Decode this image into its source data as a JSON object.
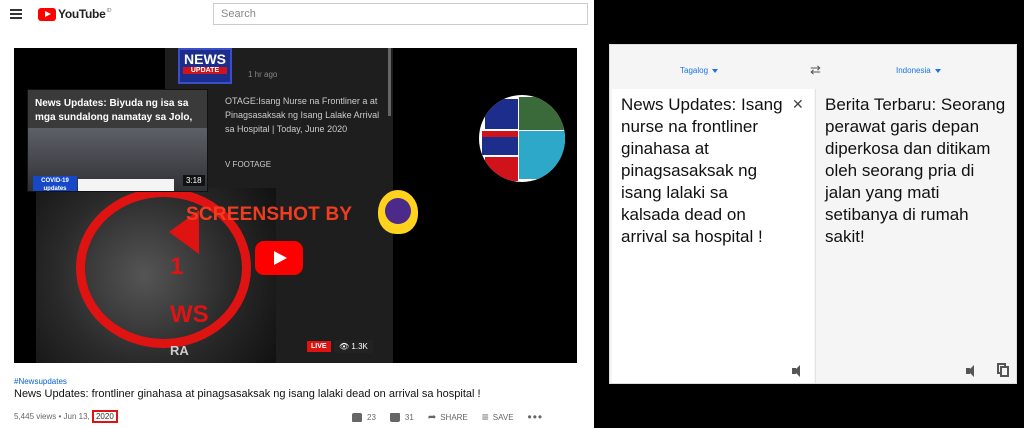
{
  "youtube": {
    "logo_text": "YouTube",
    "logo_sup": "ID",
    "search_placeholder": "Search",
    "player": {
      "channel_logo_top": "NEWS",
      "channel_logo_bottom": "UPDATE",
      "time_ago": "1 hr ago",
      "footage_caption": "OTAGE:Isang Nurse na Frontliner a at Pinagsasaksak ng Isang Lalake Arrival sa Hospital | Today, June 2020",
      "footage_label": "V FOOTAGE",
      "watermark": "SCREENSHOT BY",
      "live_label": "LIVE",
      "view_count": "1.3K",
      "big_text_1": "1",
      "big_text_2": "WS",
      "partial_text": "RA",
      "inset": {
        "title": "News Updates: Biyuda ng isa sa mga sundalong namatay sa Jolo,",
        "badge": "COVID-19 updates",
        "duration": "3:18"
      }
    },
    "hashtag": "#Newsupdates",
    "title": "News Updates: frontliner ginahasa at pinagsasaksak ng isang lalaki dead on arrival sa hospital !",
    "views_date": "5,445 views • Jun 13,",
    "year": "2020",
    "likes": "23",
    "dislikes": "31",
    "share_label": "SHARE",
    "save_label": "SAVE"
  },
  "translator": {
    "source_lang": "Tagalog",
    "target_lang": "Indonesia",
    "source_text": "News Updates: Isang nurse na frontliner ginahasa at pinagsasaksak ng isang lalaki sa kalsada dead on arrival sa hospital !",
    "target_text": "Berita Terbaru: Seorang perawat garis depan diperkosa dan ditikam oleh seorang pria di jalan yang mati setibanya di rumah sakit!"
  }
}
